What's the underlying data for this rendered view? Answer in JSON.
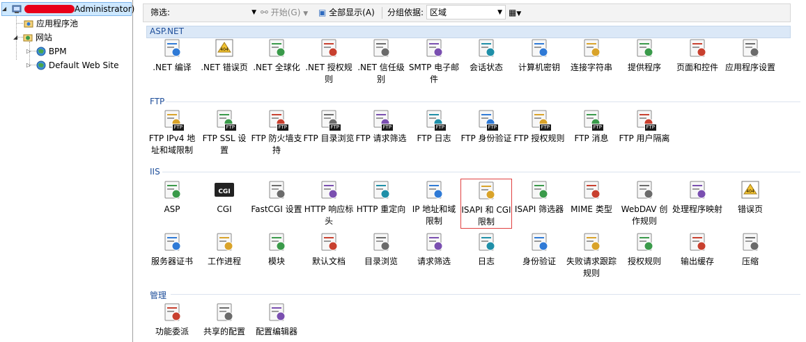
{
  "tree": {
    "root_suffix": "Administrator)",
    "items": [
      {
        "label": "应用程序池",
        "icon": "app-pool-icon"
      },
      {
        "label": "网站",
        "icon": "sites-folder-icon"
      },
      {
        "label": "BPM",
        "icon": "globe-icon"
      },
      {
        "label": "Default Web Site",
        "icon": "globe-icon"
      }
    ]
  },
  "toolbar": {
    "filter_label": "筛选:",
    "filter_value": "",
    "start_label": "开始(G)",
    "show_all_label": "全部显示(A)",
    "group_by_label": "分组依据:",
    "group_by_value": "区域"
  },
  "groups": [
    {
      "title": "ASP.NET",
      "items": [
        {
          "label": ".NET 编译",
          "icon": "net-compile-icon"
        },
        {
          "label": ".NET 错误页",
          "icon": "net-error-page-icon"
        },
        {
          "label": ".NET 全球化",
          "icon": "net-globalization-icon"
        },
        {
          "label": ".NET 授权规则",
          "icon": "net-authorization-icon"
        },
        {
          "label": ".NET 信任级别",
          "icon": "net-trust-level-icon"
        },
        {
          "label": "SMTP 电子邮件",
          "icon": "smtp-email-icon"
        },
        {
          "label": "会话状态",
          "icon": "session-state-icon"
        },
        {
          "label": "计算机密钥",
          "icon": "machine-key-icon"
        },
        {
          "label": "连接字符串",
          "icon": "connection-strings-icon"
        },
        {
          "label": "提供程序",
          "icon": "providers-icon"
        },
        {
          "label": "页面和控件",
          "icon": "pages-controls-icon"
        },
        {
          "label": "应用程序设置",
          "icon": "app-settings-icon"
        }
      ]
    },
    {
      "title": "FTP",
      "items": [
        {
          "label": "FTP IPv4 地址和域限制",
          "icon": "ftp-ipv4-icon"
        },
        {
          "label": "FTP SSL 设置",
          "icon": "ftp-ssl-icon"
        },
        {
          "label": "FTP 防火墙支持",
          "icon": "ftp-firewall-icon"
        },
        {
          "label": "FTP 目录浏览",
          "icon": "ftp-directory-browsing-icon"
        },
        {
          "label": "FTP 请求筛选",
          "icon": "ftp-request-filtering-icon"
        },
        {
          "label": "FTP 日志",
          "icon": "ftp-logging-icon"
        },
        {
          "label": "FTP 身份验证",
          "icon": "ftp-authentication-icon"
        },
        {
          "label": "FTP 授权规则",
          "icon": "ftp-authorization-icon"
        },
        {
          "label": "FTP 消息",
          "icon": "ftp-messages-icon"
        },
        {
          "label": "FTP 用户隔离",
          "icon": "ftp-user-isolation-icon"
        }
      ]
    },
    {
      "title": "IIS",
      "items": [
        {
          "label": "ASP",
          "icon": "asp-icon"
        },
        {
          "label": "CGI",
          "icon": "cgi-icon"
        },
        {
          "label": "FastCGI 设置",
          "icon": "fastcgi-icon"
        },
        {
          "label": "HTTP 响应标头",
          "icon": "http-response-headers-icon"
        },
        {
          "label": "HTTP 重定向",
          "icon": "http-redirect-icon"
        },
        {
          "label": "IP 地址和域限制",
          "icon": "ip-domain-restrictions-icon"
        },
        {
          "label": "ISAPI 和 CGI 限制",
          "icon": "isapi-cgi-restrictions-icon",
          "selected": true
        },
        {
          "label": "ISAPI 筛选器",
          "icon": "isapi-filters-icon"
        },
        {
          "label": "MIME 类型",
          "icon": "mime-types-icon"
        },
        {
          "label": "WebDAV 创作规则",
          "icon": "webdav-icon"
        },
        {
          "label": "处理程序映射",
          "icon": "handler-mappings-icon"
        },
        {
          "label": "错误页",
          "icon": "error-pages-icon"
        },
        {
          "label": "服务器证书",
          "icon": "server-certificates-icon"
        },
        {
          "label": "工作进程",
          "icon": "worker-processes-icon"
        },
        {
          "label": "模块",
          "icon": "modules-icon"
        },
        {
          "label": "默认文档",
          "icon": "default-document-icon"
        },
        {
          "label": "目录浏览",
          "icon": "directory-browsing-icon"
        },
        {
          "label": "请求筛选",
          "icon": "request-filtering-icon"
        },
        {
          "label": "日志",
          "icon": "logging-icon"
        },
        {
          "label": "身份验证",
          "icon": "authentication-icon"
        },
        {
          "label": "失败请求跟踪规则",
          "icon": "failed-request-tracing-icon"
        },
        {
          "label": "授权规则",
          "icon": "authorization-rules-icon"
        },
        {
          "label": "输出缓存",
          "icon": "output-caching-icon"
        },
        {
          "label": "压缩",
          "icon": "compression-icon"
        }
      ]
    },
    {
      "title": "管理",
      "items": [
        {
          "label": "功能委派",
          "icon": "feature-delegation-icon"
        },
        {
          "label": "共享的配置",
          "icon": "shared-configuration-icon"
        },
        {
          "label": "配置编辑器",
          "icon": "configuration-editor-icon"
        }
      ]
    }
  ]
}
